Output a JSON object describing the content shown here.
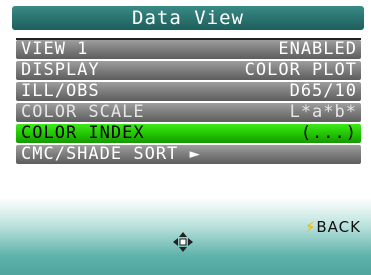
{
  "title": "Data View",
  "menu": [
    {
      "label": "VIEW 1",
      "value": "ENABLED",
      "selected": false
    },
    {
      "label": "DISPLAY",
      "value": "COLOR PLOT",
      "selected": false
    },
    {
      "label": "ILL/OBS",
      "value": "D65/10",
      "selected": false
    },
    {
      "label": "COLOR SCALE",
      "value": "L*a*b*",
      "selected": false
    },
    {
      "label": "COLOR INDEX",
      "value": "(...)",
      "selected": true
    },
    {
      "label": "CMC/SHADE SORT ►",
      "value": "",
      "selected": false
    }
  ],
  "softkeys": {
    "back_label": "BACK",
    "back_icon": "lightning-bolt-icon",
    "nav_icon": "four-way-arrow-icon"
  },
  "colors": {
    "title_bar": "#2c7672",
    "selected_row": "#21c400",
    "row": "#7c7c7c",
    "bottom_bar": "#5fb3ab"
  }
}
